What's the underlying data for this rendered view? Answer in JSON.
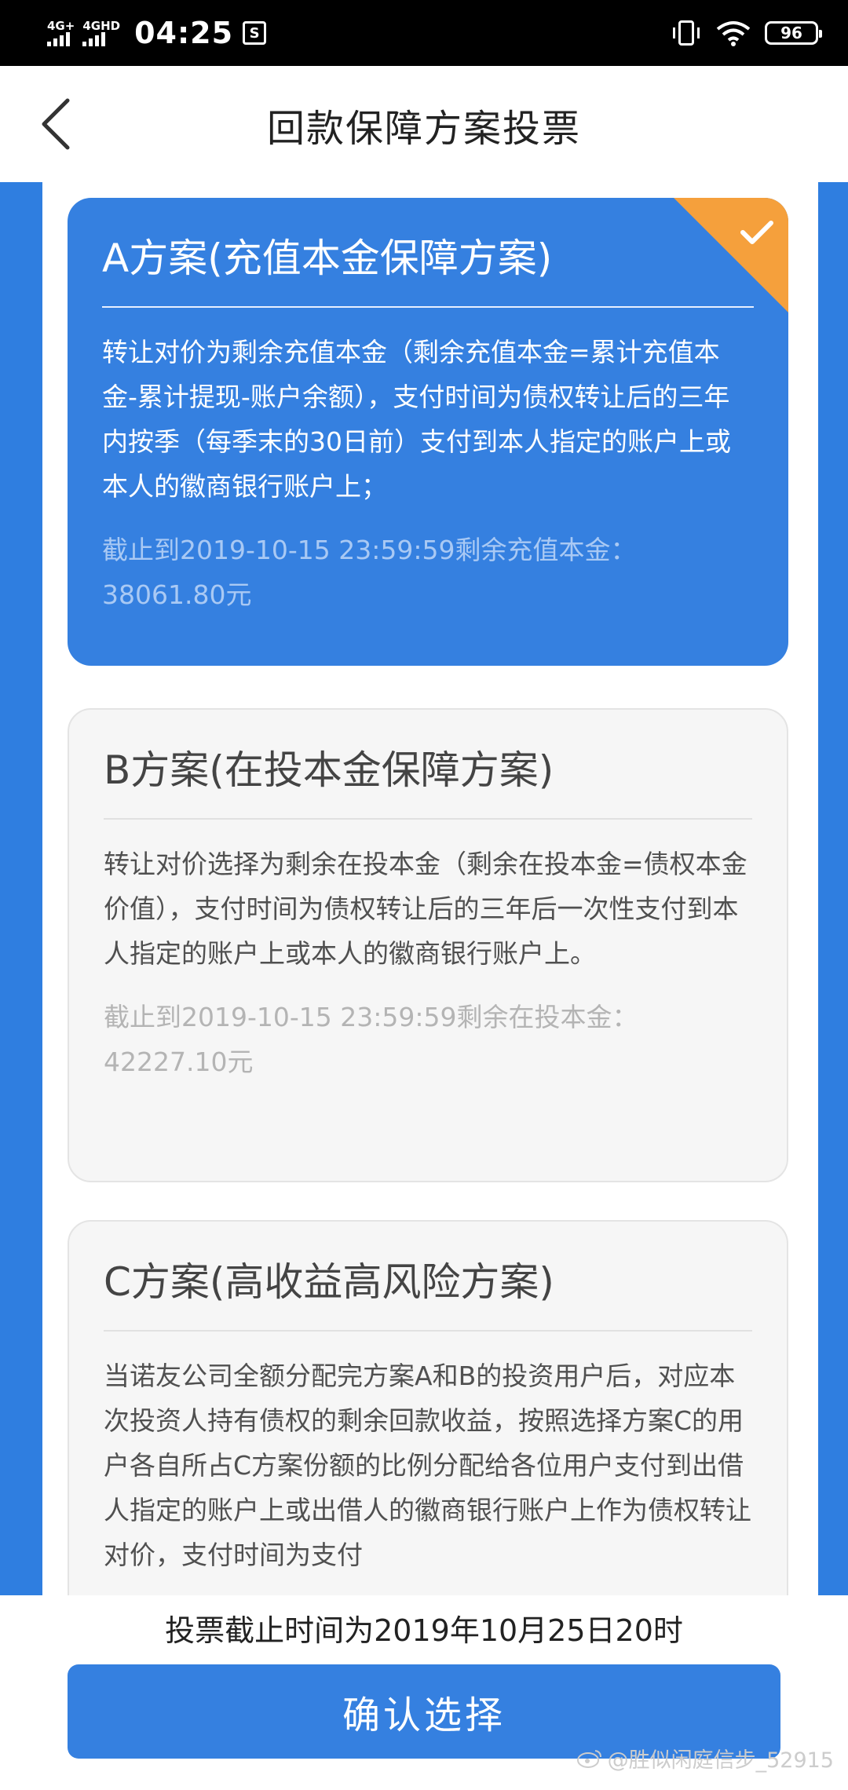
{
  "status_bar": {
    "network1": "4G+",
    "network2": "4GHD",
    "time": "04:25",
    "notification_glyph": "S",
    "battery": "96"
  },
  "nav": {
    "title": "回款保障方案投票",
    "back_icon": "chevron-left-icon"
  },
  "plans": [
    {
      "title": "A方案(充值本金保障方案)",
      "description": "转让对价为剩余充值本金（剩余充值本金=累计充值本金-累计提现-账户余额），支付时间为债权转让后的三年内按季（每季末的30日前）支付到本人指定的账户上或本人的徽商银行账户上；",
      "meta": "截止到2019-10-15 23:59:59剩余充值本金：38061.80元",
      "selected": true
    },
    {
      "title": "B方案(在投本金保障方案)",
      "description": "转让对价选择为剩余在投本金（剩余在投本金=债权本金价值），支付时间为债权转让后的三年后一次性支付到本人指定的账户上或本人的徽商银行账户上。",
      "meta": "截止到2019-10-15 23:59:59剩余在投本金：42227.10元",
      "selected": false
    },
    {
      "title": "C方案(高收益高风险方案)",
      "description": "当诺友公司全额分配完方案A和B的投资用户后，对应本次投资人持有债权的剩余回款收益，按照选择方案C的用户各自所占C方案份额的比例分配给各位用户支付到出借人指定的账户上或出借人的徽商银行账户上作为债权转让对价，支付时间为支付",
      "selected": false
    }
  ],
  "footer": {
    "deadline": "投票截止时间为2019年10月25日20时",
    "confirm_label": "确认选择"
  },
  "watermark": "@胜似闲庭信步_52915",
  "colors": {
    "accent": "#3580e0",
    "side_blue": "#2f7ee0",
    "check_corner": "#f5a03c"
  }
}
